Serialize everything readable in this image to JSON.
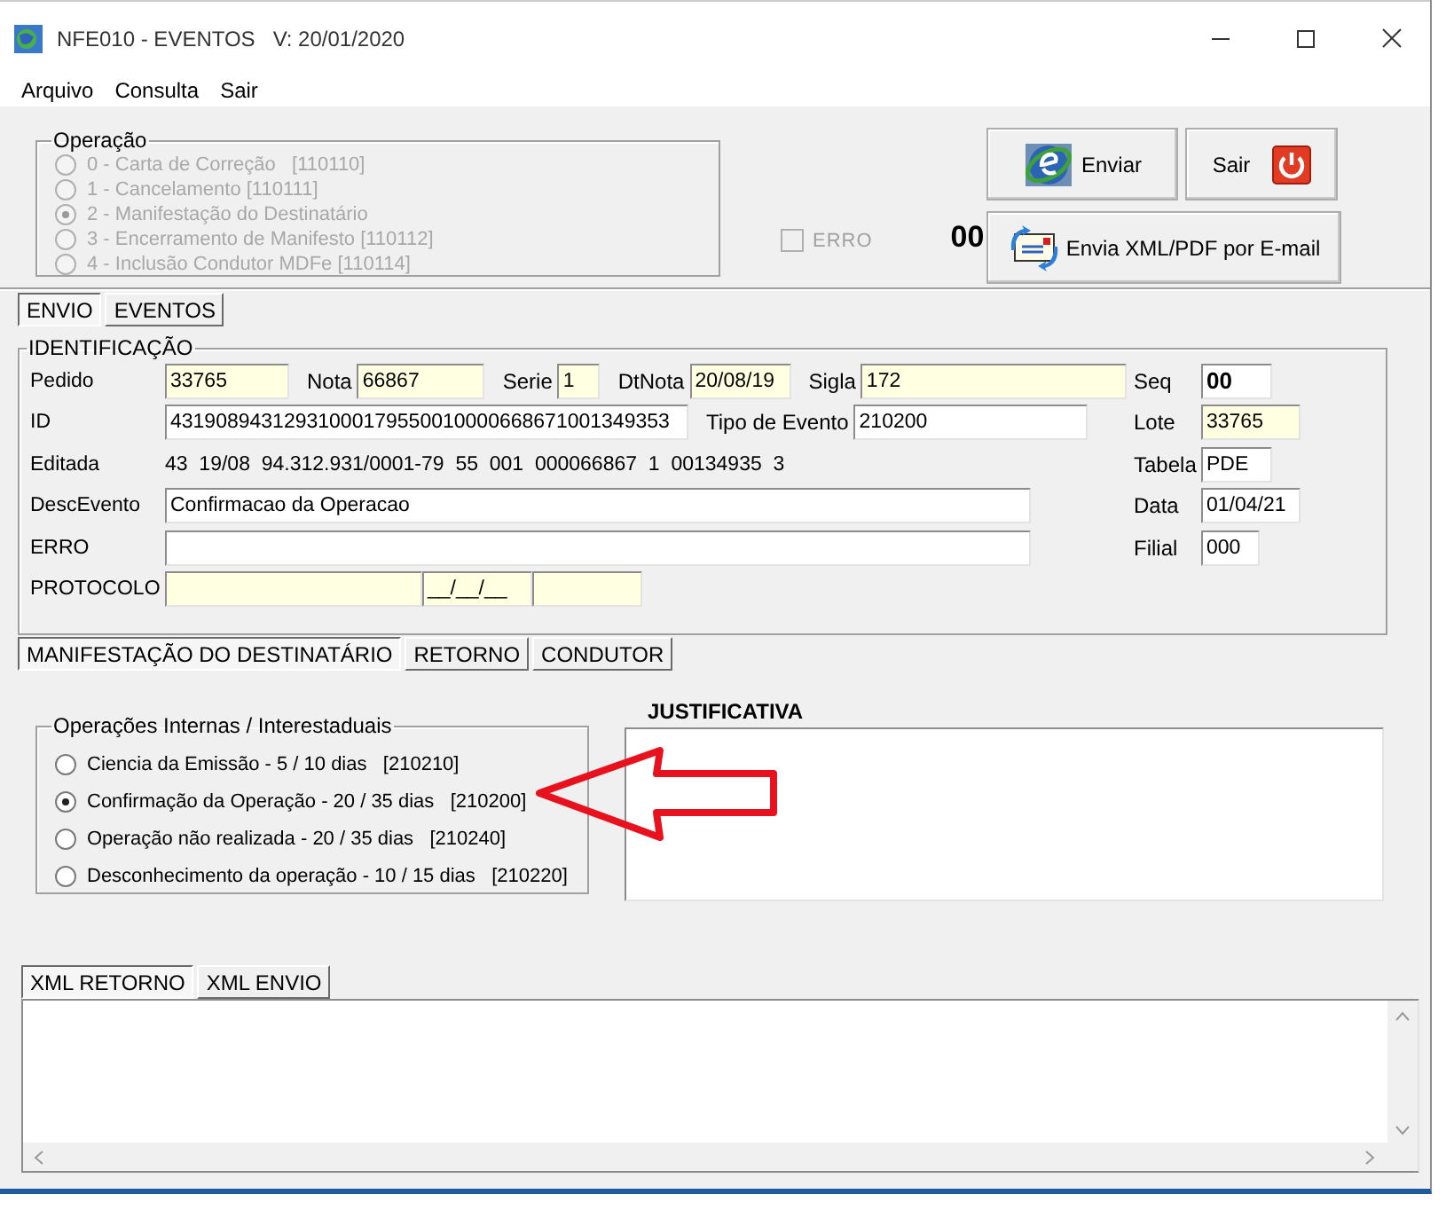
{
  "window": {
    "title": "NFE010 - EVENTOS   V: 20/01/2020"
  },
  "menu": [
    "Arquivo",
    "Consulta",
    "Sair"
  ],
  "operacao": {
    "legend": "Operação",
    "options": [
      {
        "label": "0 - Carta de Correção   [110110]",
        "selected": false,
        "disabled": true
      },
      {
        "label": "1 - Cancelamento [110111]",
        "selected": false,
        "disabled": true
      },
      {
        "label": "2 - Manifestação do Destinatário",
        "selected": true,
        "disabled": true
      },
      {
        "label": "3 - Encerramento de Manifesto [110112]",
        "selected": false,
        "disabled": true
      },
      {
        "label": "4 - Inclusão Condutor MDFe [110114]",
        "selected": false,
        "disabled": true
      }
    ]
  },
  "erro": {
    "label": "ERRO",
    "checked": false,
    "disabled": true
  },
  "counter": "00",
  "buttons": [
    {
      "label": "Enviar",
      "kind": "send"
    },
    {
      "label": "Sair",
      "kind": "exit"
    },
    {
      "label": "Envia XML/PDF por E-mail",
      "kind": "email"
    }
  ],
  "main_tabs": [
    {
      "label": "ENVIO",
      "selected": true
    },
    {
      "label": "EVENTOS",
      "selected": false
    }
  ],
  "identificacao": {
    "legend": "IDENTIFICAÇÃO",
    "rows": [
      {
        "items": [
          {
            "kind": "label",
            "text": "Pedido"
          },
          {
            "kind": "field",
            "value": "33765",
            "readonly": true
          },
          {
            "kind": "label",
            "text": "Nota"
          },
          {
            "kind": "field",
            "value": "66867",
            "readonly": true
          },
          {
            "kind": "label",
            "text": "Serie"
          },
          {
            "kind": "field",
            "value": "1",
            "readonly": true
          },
          {
            "kind": "label",
            "text": "DtNota"
          },
          {
            "kind": "field",
            "value": "20/08/19",
            "readonly": true
          },
          {
            "kind": "label",
            "text": "Sigla"
          },
          {
            "kind": "field",
            "value": "172",
            "readonly": true
          }
        ]
      },
      {
        "items": [
          {
            "kind": "label",
            "text": "ID"
          },
          {
            "kind": "field",
            "value": "43190894312931000179550010000668671001349353",
            "readonly": false
          },
          {
            "kind": "label",
            "text": "Tipo de Evento"
          },
          {
            "kind": "field",
            "value": "210200",
            "readonly": false
          }
        ]
      },
      {
        "items": [
          {
            "kind": "label",
            "text": "Editada"
          },
          {
            "kind": "text",
            "text": "43  19/08  94.312.931/0001-79  55  001  000066867  1  00134935  3"
          }
        ]
      },
      {
        "items": [
          {
            "kind": "label",
            "text": "DescEvento"
          },
          {
            "kind": "field",
            "value": "Confirmacao da Operacao",
            "readonly": false
          }
        ]
      },
      {
        "items": [
          {
            "kind": "label",
            "text": "ERRO"
          },
          {
            "kind": "field",
            "readonly": false
          }
        ]
      },
      {
        "items": [
          {
            "kind": "label",
            "text": "PROTOCOLO"
          },
          {
            "kind": "field",
            "readonly": true
          },
          {
            "kind": "field",
            "value": "__/__/__",
            "readonly": true
          },
          {
            "kind": "field",
            "readonly": true
          }
        ]
      }
    ],
    "side": [
      {
        "label": "Seq",
        "value": "00",
        "readonly": false
      },
      {
        "label": "Lote",
        "value": "33765",
        "readonly": true
      },
      {
        "label": "Tabela",
        "value": "PDE",
        "readonly": false
      },
      {
        "label": "Data",
        "value": "01/04/21",
        "readonly": false
      },
      {
        "label": "Filial",
        "value": "000",
        "readonly": false
      }
    ]
  },
  "sub_tabs": [
    {
      "label": "MANIFESTAÇÃO DO DESTINATÁRIO",
      "selected": true
    },
    {
      "label": "RETORNO",
      "selected": false
    },
    {
      "label": "CONDUTOR",
      "selected": false
    }
  ],
  "operacoes": {
    "legend": "Operações Internas / Interestaduais",
    "options": [
      {
        "label": "Ciencia da Emissão - 5 / 10 dias   [210210]",
        "selected": false,
        "disabled": false
      },
      {
        "label": "Confirmação da Operação - 20 / 35 dias   [210200]",
        "selected": true,
        "disabled": false
      },
      {
        "label": "Operação não realizada - 20 / 35 dias   [210240]",
        "selected": false,
        "disabled": false
      },
      {
        "label": "Desconhecimento da operação - 10 / 15 dias   [210220]",
        "selected": false,
        "disabled": false
      }
    ]
  },
  "justificativa": {
    "label": "JUSTIFICATIVA"
  },
  "xml_tabs": [
    {
      "label": "XML RETORNO",
      "selected": true
    },
    {
      "label": "XML ENVIO",
      "selected": false
    }
  ],
  "annotation": {
    "kind": "arrow"
  }
}
